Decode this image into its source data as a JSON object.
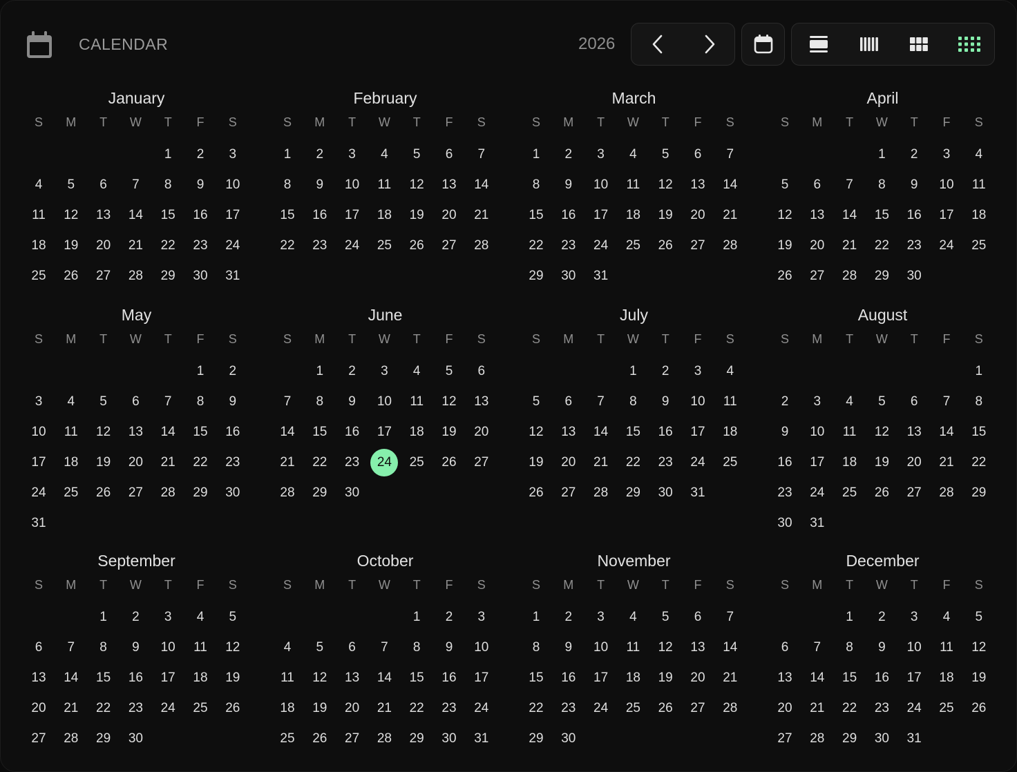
{
  "app": {
    "title": "CALENDAR"
  },
  "toolbar": {
    "year": "2026",
    "prev_icon": "chevron-left-icon",
    "next_icon": "chevron-right-icon",
    "today_icon": "calendar-icon",
    "views": [
      {
        "icon": "day-view-icon",
        "active": false
      },
      {
        "icon": "week-view-icon",
        "active": false
      },
      {
        "icon": "month-view-icon",
        "active": false
      },
      {
        "icon": "year-view-icon",
        "active": true
      }
    ]
  },
  "colors": {
    "accent": "#86efac",
    "background": "#0e0e0e",
    "text": "#dedede",
    "muted": "#8f8f8f"
  },
  "weekdays": [
    "S",
    "M",
    "T",
    "W",
    "T",
    "F",
    "S"
  ],
  "today": {
    "month": 6,
    "day": 24
  },
  "months": [
    {
      "name": "January",
      "start": 4,
      "days": 31
    },
    {
      "name": "February",
      "start": 0,
      "days": 28
    },
    {
      "name": "March",
      "start": 0,
      "days": 31
    },
    {
      "name": "April",
      "start": 3,
      "days": 30
    },
    {
      "name": "May",
      "start": 5,
      "days": 31
    },
    {
      "name": "June",
      "start": 1,
      "days": 30
    },
    {
      "name": "July",
      "start": 3,
      "days": 31
    },
    {
      "name": "August",
      "start": 6,
      "days": 31
    },
    {
      "name": "September",
      "start": 2,
      "days": 30
    },
    {
      "name": "October",
      "start": 4,
      "days": 31
    },
    {
      "name": "November",
      "start": 0,
      "days": 30
    },
    {
      "name": "December",
      "start": 2,
      "days": 31
    }
  ]
}
